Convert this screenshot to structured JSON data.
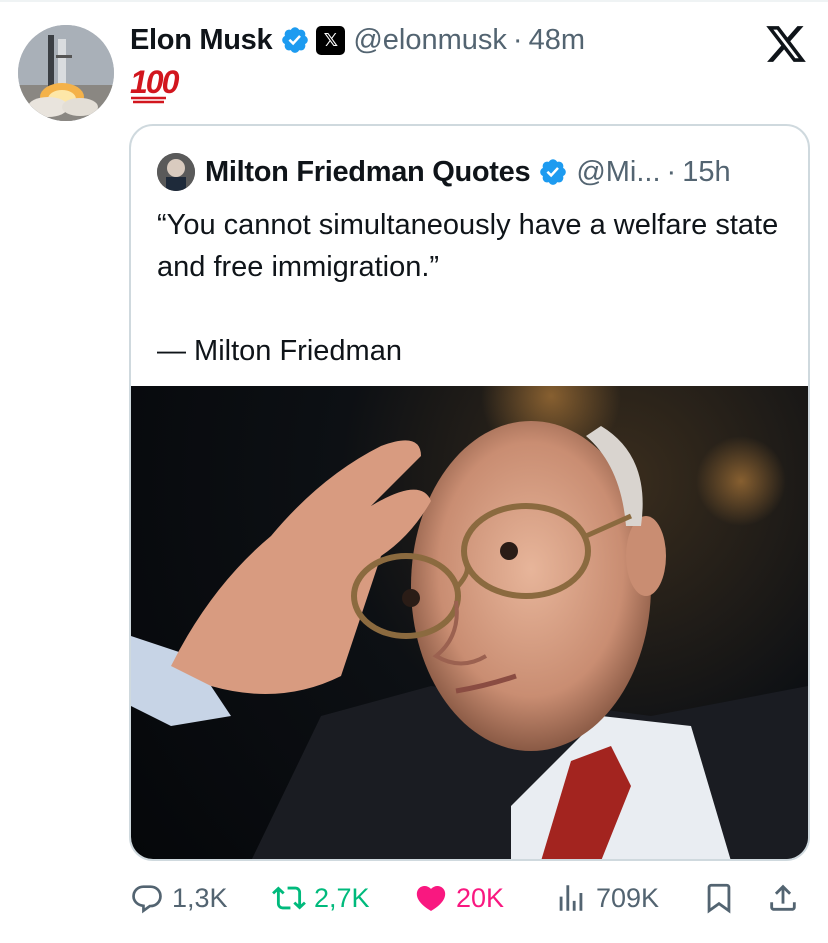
{
  "tweet": {
    "author_name": "Elon Musk",
    "affiliate_badge": "𝕏",
    "handle": "@elonmusk",
    "separator": "·",
    "time": "48m",
    "text": "100"
  },
  "quoted": {
    "author_name": "Milton Friedman Quotes",
    "handle": "@Mi...",
    "separator": "·",
    "time": "15h",
    "text": "“You cannot simultaneously have a welfare state and free immigration.”\n\n— Milton Friedman"
  },
  "actions": {
    "replies": "1,3K",
    "reposts": "2,7K",
    "likes": "20K",
    "views": "709K"
  },
  "icons": {
    "verified": "verified-badge-icon",
    "x_logo": "x-logo-icon",
    "reply": "reply-icon",
    "repost": "repost-icon",
    "like": "heart-icon",
    "views": "views-icon",
    "bookmark": "bookmark-icon",
    "share": "share-icon"
  },
  "colors": {
    "verified": "#1d9bf0",
    "repost_active": "#00ba7c",
    "like_active": "#f91880",
    "secondary_text": "#536471",
    "border": "#cfd9de"
  }
}
